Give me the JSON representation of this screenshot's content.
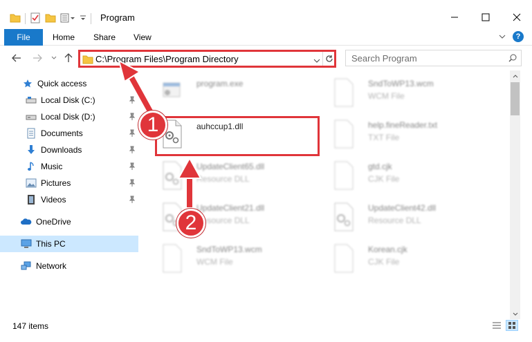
{
  "window": {
    "title": "Program"
  },
  "ribbon": {
    "tabs": [
      "File",
      "Home",
      "Share",
      "View"
    ],
    "help": "?"
  },
  "address": {
    "path": "C:\\Program Files\\Program Directory"
  },
  "search": {
    "placeholder": "Search Program"
  },
  "sidebar": {
    "items": [
      {
        "label": "Quick access",
        "icon": "star-icon"
      },
      {
        "label": "Local Disk (C:)",
        "icon": "drive-icon",
        "pinned": true
      },
      {
        "label": "Local Disk (D:)",
        "icon": "drive-icon",
        "pinned": true
      },
      {
        "label": "Documents",
        "icon": "documents-icon",
        "pinned": true
      },
      {
        "label": "Downloads",
        "icon": "downloads-icon",
        "pinned": true
      },
      {
        "label": "Music",
        "icon": "music-icon",
        "pinned": true
      },
      {
        "label": "Pictures",
        "icon": "pictures-icon",
        "pinned": true
      },
      {
        "label": "Videos",
        "icon": "videos-icon",
        "pinned": true
      },
      {
        "label": "OneDrive",
        "icon": "onedrive-icon"
      },
      {
        "label": "This PC",
        "icon": "this-pc-icon",
        "selected": true
      },
      {
        "label": "Network",
        "icon": "network-icon"
      }
    ]
  },
  "files": [
    {
      "name": "program.exe",
      "type": "",
      "icon": "exe-icon"
    },
    {
      "name": "SndToWP13.wcm",
      "type": "WCM File",
      "icon": "file-icon"
    },
    {
      "name": "auhccup1.dll",
      "type": "",
      "icon": "dll-gear-icon",
      "highlighted": true
    },
    {
      "name": "help.fineReader.txt",
      "type": "TXT File",
      "icon": "file-icon"
    },
    {
      "name": "UpdateClient65.dll",
      "type": "Resource DLL",
      "icon": "dll-gear-icon"
    },
    {
      "name": "gtd.cjk",
      "type": "CJK File",
      "icon": "file-icon"
    },
    {
      "name": "UpdateClient21.dll",
      "type": "Resource DLL",
      "icon": "dll-gear-icon"
    },
    {
      "name": "UpdateClient42.dll",
      "type": "Resource DLL",
      "icon": "dll-gear-icon"
    },
    {
      "name": "SndToWP13.wcm",
      "type": "WCM File",
      "icon": "file-icon"
    },
    {
      "name": "Korean.cjk",
      "type": "CJK File",
      "icon": "file-icon"
    }
  ],
  "status": {
    "count": "147 items"
  },
  "callouts": [
    "1",
    "2"
  ],
  "colors": {
    "accent": "#1979ca",
    "annotation": "#e0353a",
    "selected": "#cce8ff"
  }
}
